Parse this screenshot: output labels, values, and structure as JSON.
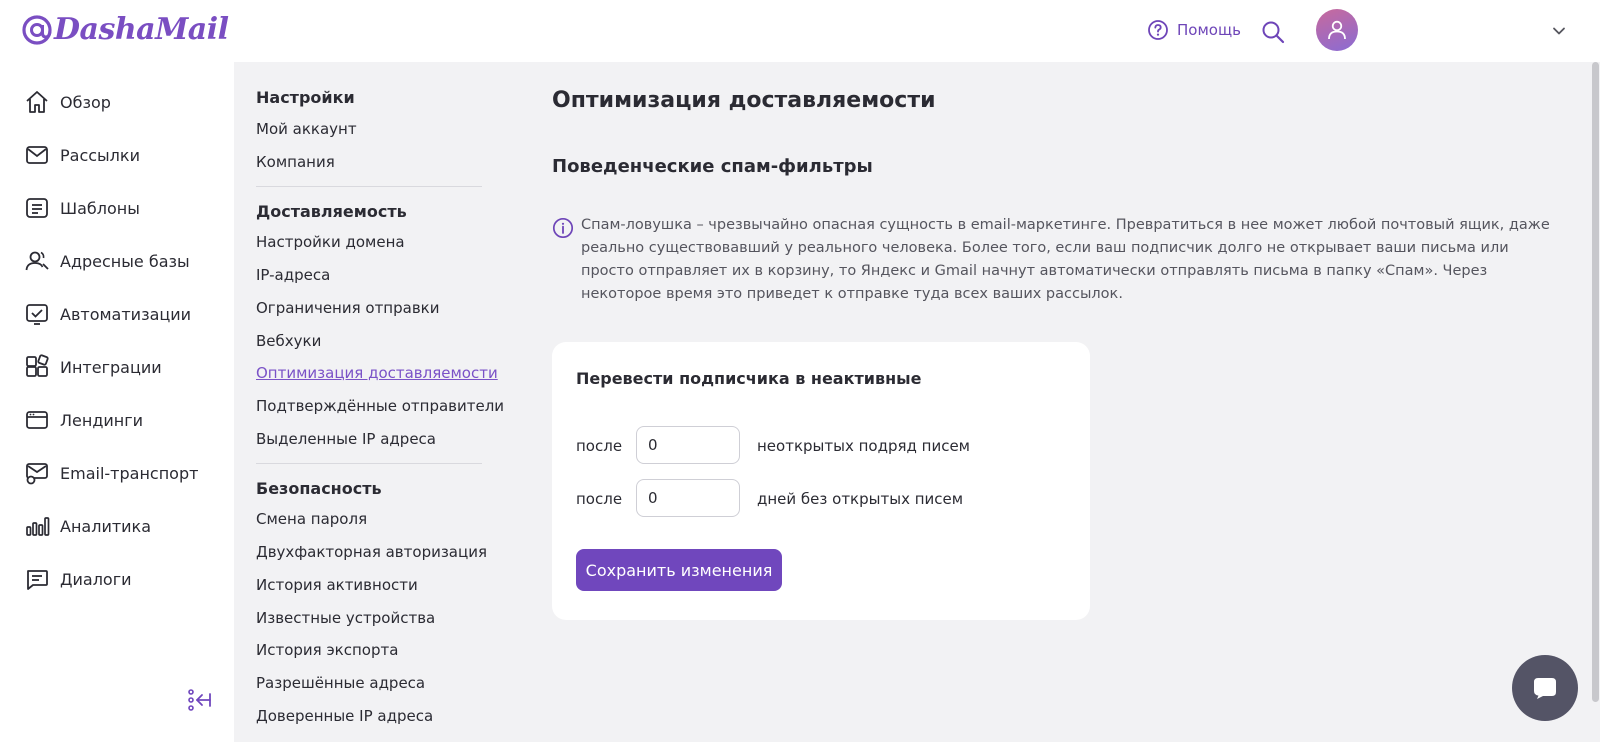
{
  "header": {
    "logo_text": "DashaMail",
    "help_label": "Помощь"
  },
  "leftnav": {
    "items": [
      {
        "label": "Обзор",
        "icon": "home-icon"
      },
      {
        "label": "Рассылки",
        "icon": "mail-icon"
      },
      {
        "label": "Шаблоны",
        "icon": "template-icon"
      },
      {
        "label": "Адресные базы",
        "icon": "contacts-icon"
      },
      {
        "label": "Автоматизации",
        "icon": "automation-icon"
      },
      {
        "label": "Интеграции",
        "icon": "integrations-icon"
      },
      {
        "label": "Лендинги",
        "icon": "landing-icon"
      },
      {
        "label": "Email-транспорт",
        "icon": "transport-icon"
      },
      {
        "label": "Аналитика",
        "icon": "analytics-icon"
      },
      {
        "label": "Диалоги",
        "icon": "dialogs-icon"
      }
    ]
  },
  "submenu": {
    "groups": [
      {
        "title": "Настройки",
        "items": [
          "Мой аккаунт",
          "Компания"
        ]
      },
      {
        "title": "Доставляемость",
        "items": [
          "Настройки домена",
          "IP-адреса",
          "Ограничения отправки",
          "Вебхуки",
          "Оптимизация доставляемости",
          "Подтверждённые отправители",
          "Выделенные IP адреса"
        ]
      },
      {
        "title": "Безопасность",
        "items": [
          "Смена пароля",
          "Двухфакторная авторизация",
          "История активности",
          "Известные устройства",
          "История экспорта",
          "Разрешённые адреса",
          "Доверенные IP адреса"
        ]
      }
    ],
    "active_item": "Оптимизация доставляемости"
  },
  "main": {
    "page_title": "Оптимизация доставляемости",
    "section_title": "Поведенческие спам-фильтры",
    "info_text": "Спам-ловушка – чрезвычайно опасная сущность в email-маркетинге. Превратиться в нее может любой почтовый ящик, даже реально существовавший у реального человека. Более того, если ваш подписчик долго не открывает ваши письма или просто отправляет их в корзину, то Яндекс и Gmail начнут автоматически отправлять письма в папку «Спам». Через некоторое время это приведет к отправке туда всех ваших рассылок.",
    "card": {
      "title": "Перевести подписчика в неактивные",
      "row1": {
        "prefix": "после",
        "value": "0",
        "suffix": "неоткрытых подряд писем"
      },
      "row2": {
        "prefix": "после",
        "value": "0",
        "suffix": "дней без открытых писем"
      },
      "save_label": "Сохранить изменения"
    }
  },
  "colors": {
    "accent": "#7047bd",
    "link_active": "#7a52c7",
    "panel_bg": "#f2f2f4"
  }
}
